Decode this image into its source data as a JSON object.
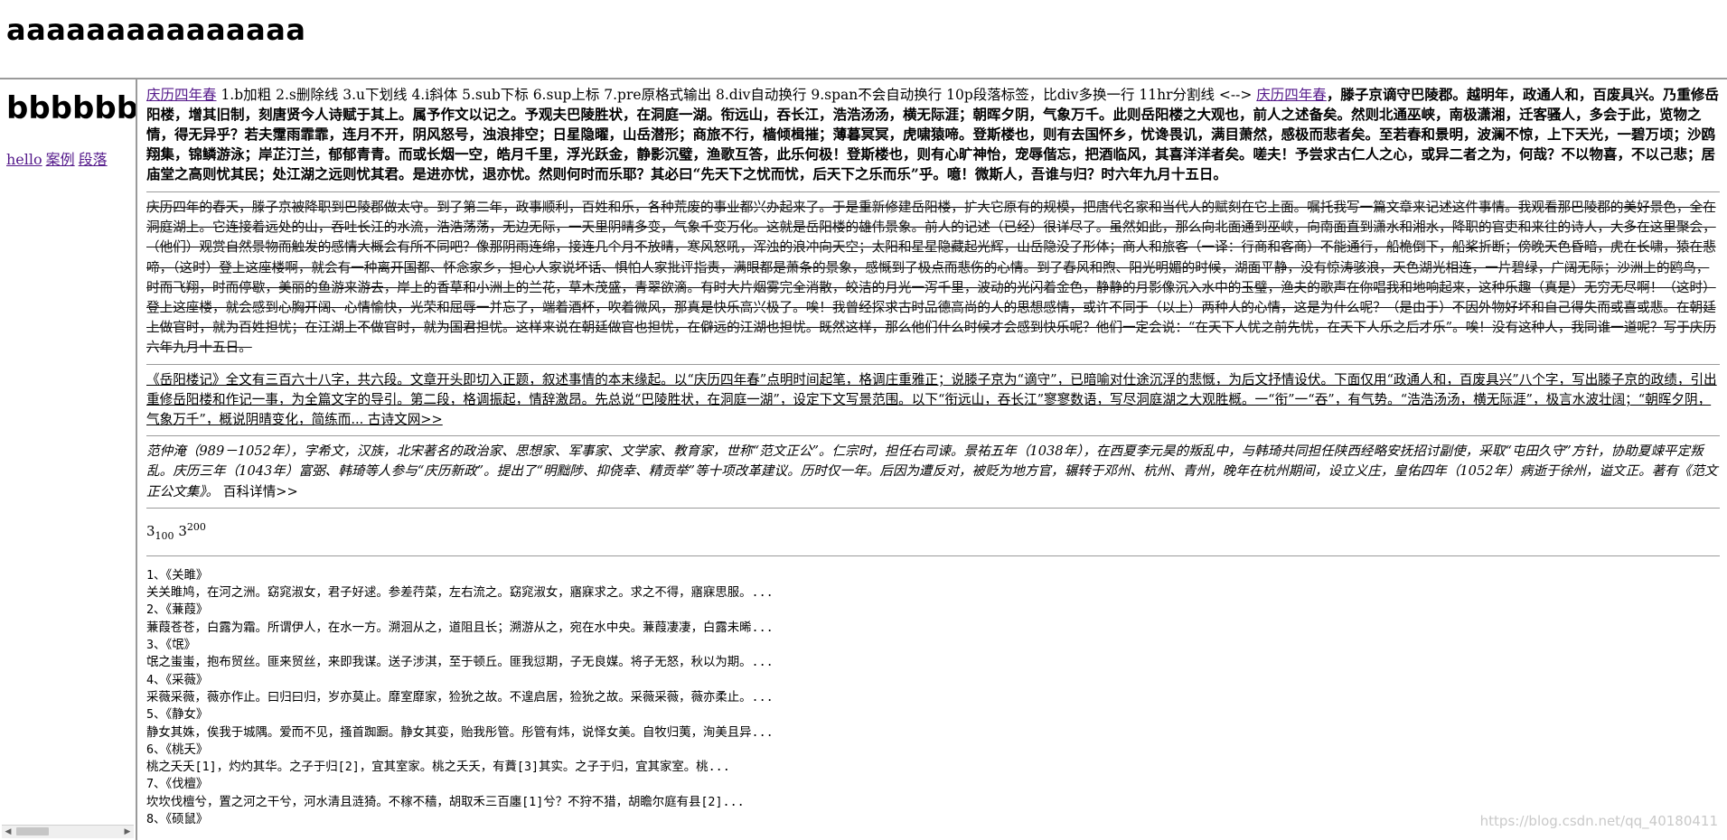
{
  "top": {
    "title": "aaaaaaaaaaaaaaa"
  },
  "left": {
    "title": "bbbbbbb",
    "links": [
      "hello",
      "案例",
      "段落"
    ]
  },
  "main": {
    "p1": {
      "link1": "庆历四年春",
      "feature_list": " 1.b加粗 2.s删除线 3.u下划线 4.i斜体 5.sub下标 6.sup上标 7.pre原格式输出 8.div自动换行 9.span不会自动换行 10p段落标签，比div多换一行 11hr分割线 <--> ",
      "link2": "庆历四年春",
      "bold_text": "，滕子京谪守巴陵郡。越明年，政通人和，百废具兴。乃重修岳阳楼，增其旧制，刻唐贤今人诗赋于其上。属予作文以记之。予观夫巴陵胜状，在洞庭一湖。衔远山，吞长江，浩浩汤汤，横无际涯；朝晖夕阴，气象万千。此则岳阳楼之大观也，前人之述备矣。然则北通巫峡，南极潇湘，迁客骚人，多会于此，览物之情，得无异乎？若夫霪雨霏霏，连月不开，阴风怒号，浊浪排空；日星隐曜，山岳潜形；商旅不行，樯倾楫摧；薄暮冥冥，虎啸猿啼。登斯楼也，则有去国怀乡，忧谗畏讥，满目萧然，感极而悲者矣。至若春和景明，波澜不惊，上下天光，一碧万顷；沙鸥翔集，锦鳞游泳；岸芷汀兰，郁郁青青。而或长烟一空，皓月千里，浮光跃金，静影沉璧，渔歌互答，此乐何极！登斯楼也，则有心旷神怡，宠辱偕忘，把酒临风，其喜洋洋者矣。嗟夫！予尝求古仁人之心，或异二者之为，何哉？不以物喜，不以己悲；居庙堂之高则忧其民；处江湖之远则忧其君。是进亦忧，退亦忧。然则何时而乐耶？其必曰“先天下之忧而忧，后天下之乐而乐”乎。噫！微斯人，吾谁与归？时六年九月十五日。"
    },
    "p2": "庆历四年的春天，滕子京被降职到巴陵郡做太守。到了第二年，政事顺利，百姓和乐，各种荒废的事业都兴办起来了。于是重新修建岳阳楼，扩大它原有的规模，把唐代名家和当代人的赋刻在它上面。嘱托我写一篇文章来记述这件事情。我观看那巴陵郡的美好景色，全在洞庭湖上。它连接着远处的山，吞吐长江的水流，浩浩荡荡，无边无际，一天里阴晴多变，气象千变万化。这就是岳阳楼的雄伟景象。前人的记述（已经）很详尽了。虽然如此，那么向北面通到巫峡，向南面直到潇水和湘水，降职的官吏和来往的诗人，大多在这里聚会，（他们）观赏自然景物而触发的感情大概会有所不同吧？像那阴雨连绵，接连几个月不放晴，寒风怒吼，浑浊的浪冲向天空；太阳和星星隐藏起光辉，山岳隐没了形体；商人和旅客（一译：行商和客商）不能通行，船桅倒下，船桨折断；傍晚天色昏暗，虎在长啸，猿在悲啼，（这时）登上这座楼啊，就会有一种离开国都、怀念家乡，担心人家说坏话、惧怕人家批评指责，满眼都是萧条的景象，感慨到了极点而悲伤的心情。到了春风和煦、阳光明媚的时候，湖面平静，没有惊涛骇浪，天色湖光相连，一片碧绿，广阔无际；沙洲上的鸥鸟，时而飞翔，时而停歇，美丽的鱼游来游去，岸上的香草和小洲上的兰花，草木茂盛，青翠欲滴。有时大片烟雾完全消散，皎洁的月光一泻千里，波动的光闪着金色，静静的月影像沉入水中的玉璧，渔夫的歌声在你唱我和地响起来，这种乐趣（真是）无穷无尽啊！（这时）登上这座楼，就会感到心胸开阔、心情愉快，光荣和屈辱一并忘了，端着酒杯，吹着微风，那真是快乐高兴极了。唉！我曾经探求古时品德高尚的人的思想感情，或许不同于（以上）两种人的心情，这是为什么呢？（是由于）不因外物好坏和自己得失而或喜或悲。在朝廷上做官时，就为百姓担忧；在江湖上不做官时，就为国君担忧。这样来说在朝廷做官也担忧，在僻远的江湖也担忧。既然这样，那么他们什么时候才会感到快乐呢？他们一定会说：“在天下人忧之前先忧，在天下人乐之后才乐”。唉！没有这种人，我同谁一道呢？写于庆历六年九月十五日。",
    "p3": "《岳阳楼记》全文有三百六十八字，共六段。文章开头即切入正题，叙述事情的本末缘起。以“庆历四年春”点明时间起笔，格调庄重雅正；说滕子京为“谪守”，已暗喻对仕途沉浮的悲慨，为后文抒情设伏。下面仅用“政通人和，百废具兴”八个字，写出滕子京的政绩，引出重修岳阳楼和作记一事，为全篇文字的导引。第二段，格调振起，情辞激昂。先总说“巴陵胜状，在洞庭一湖”，设定下文写景范围。以下“衔远山，吞长江”寥寥数语，写尽洞庭湖之大观胜概。一“衔”一“吞”，有气势。“浩浩汤汤，横无际涯”，极言水波壮阔；“朝晖夕阴，气象万千”，概说阴晴变化，简练而... 古诗文网>>",
    "p4": {
      "text": "范仲淹（989－1052年），字希文，汉族，北宋著名的政治家、思想家、军事家、文学家、教育家，世称“范文正公”。仁宗时，担任右司谏。景祐五年（1038年），在西夏李元昊的叛乱中，与韩琦共同担任陕西经略安抚招讨副使，采取“屯田久守”方针，协助夏竦平定叛乱。庆历三年（1043年）富弼、韩琦等人参与“庆历新政”。提出了“明黜陟、抑侥幸、精贡举”等十项改革建议。历时仅一年。后因为遭反对，被贬为地方官，辗转于邓州、杭州、青州，晚年在杭州期间，设立义庄，皇佑四年（1052年）病逝于徐州，谥文正。著有《范文正公文集》。 ",
      "more": "百科详情>>"
    },
    "p5": {
      "base1": "3",
      "sub": "100",
      "base2": "3",
      "sup": "200"
    },
    "poems": "1、《关雎》\n关关雎鸠，在河之洲。窈窕淑女，君子好逑。参差荇菜，左右流之。窈窕淑女，寤寐求之。求之不得，寤寐思服。...\n2、《蒹葭》\n蒹葭苍苍，白露为霜。所谓伊人，在水一方。溯洄从之，道阻且长；溯游从之，宛在水中央。蒹葭凄凄，白露未晞...\n3、《氓》\n氓之蚩蚩，抱布贸丝。匪来贸丝，来即我谋。送子涉淇，至于顿丘。匪我愆期，子无良媒。将子无怒，秋以为期。...\n4、《采薇》\n采薇采薇，薇亦作止。曰归曰归，岁亦莫止。靡室靡家，猃狁之故。不遑启居，猃狁之故。采薇采薇，薇亦柔止。...\n5、《静女》\n静女其姝，俟我于城隅。爱而不见，搔首踟蹰。静女其娈，贻我彤管。彤管有炜，说怿女美。自牧归荑，洵美且异...\n6、《桃夭》\n桃之夭夭[1]，灼灼其华。之子于归[2]，宜其室家。桃之夭夭，有蕡[3]其实。之子于归，宜其家室。桃...\n7、《伐檀》\n坎坎伐檀兮，置之河之干兮，河水清且涟猗。不稼不穑，胡取禾三百廛[1]兮？不狩不猎，胡瞻尔庭有县[2]...\n8、《硕鼠》"
  },
  "watermark": "https://blog.csdn.net/qq_40180411"
}
